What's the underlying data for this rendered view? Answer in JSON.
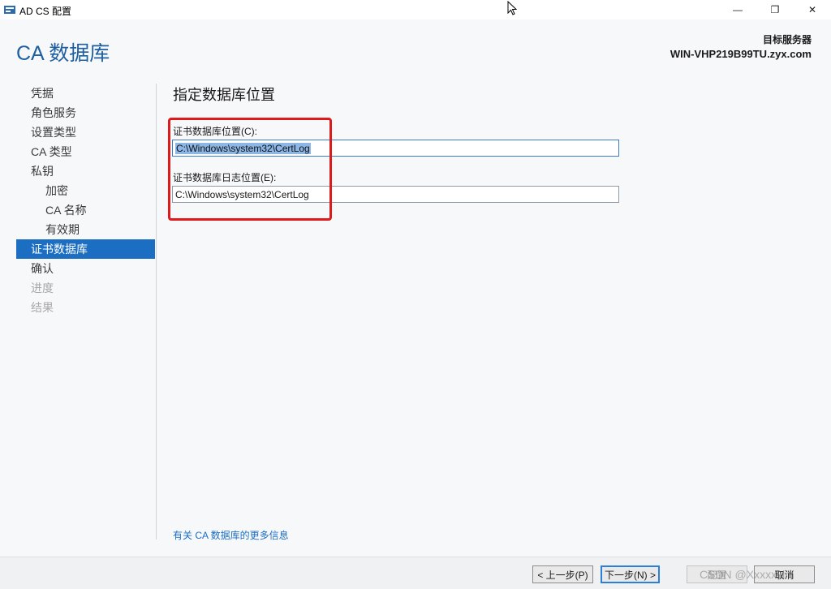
{
  "window": {
    "title": "AD CS 配置",
    "minimize_glyph": "—",
    "maximize_glyph": "❐",
    "close_glyph": "✕"
  },
  "header": {
    "title": "CA 数据库",
    "target_label": "目标服务器",
    "target_server": "WIN-VHP219B99TU.zyx.com"
  },
  "nav": {
    "items": [
      {
        "label": "凭据",
        "state": "normal",
        "level": 0
      },
      {
        "label": "角色服务",
        "state": "normal",
        "level": 0
      },
      {
        "label": "设置类型",
        "state": "normal",
        "level": 0
      },
      {
        "label": "CA 类型",
        "state": "normal",
        "level": 0
      },
      {
        "label": "私钥",
        "state": "normal",
        "level": 0
      },
      {
        "label": "加密",
        "state": "normal",
        "level": 1
      },
      {
        "label": "CA 名称",
        "state": "normal",
        "level": 1
      },
      {
        "label": "有效期",
        "state": "normal",
        "level": 1
      },
      {
        "label": "证书数据库",
        "state": "active",
        "level": 0
      },
      {
        "label": "确认",
        "state": "normal",
        "level": 0
      },
      {
        "label": "进度",
        "state": "disabled",
        "level": 0
      },
      {
        "label": "结果",
        "state": "disabled",
        "level": 0
      }
    ]
  },
  "main": {
    "heading": "指定数据库位置",
    "db_location_label": "证书数据库位置(C):",
    "db_location_value": "C:\\Windows\\system32\\CertLog",
    "log_location_label": "证书数据库日志位置(E):",
    "log_location_value": "C:\\Windows\\system32\\CertLog",
    "more_info_link": "有关 CA 数据库的更多信息"
  },
  "footer": {
    "prev_label": "< 上一步(P)",
    "next_label": "下一步(N) >",
    "configure_label": "配置",
    "cancel_label": "取消",
    "watermark": "CSDN @Xxxxxxin."
  },
  "colors": {
    "accent": "#1b6ec2",
    "title_blue": "#1e5fa0",
    "highlight_red": "#e01a1a"
  }
}
